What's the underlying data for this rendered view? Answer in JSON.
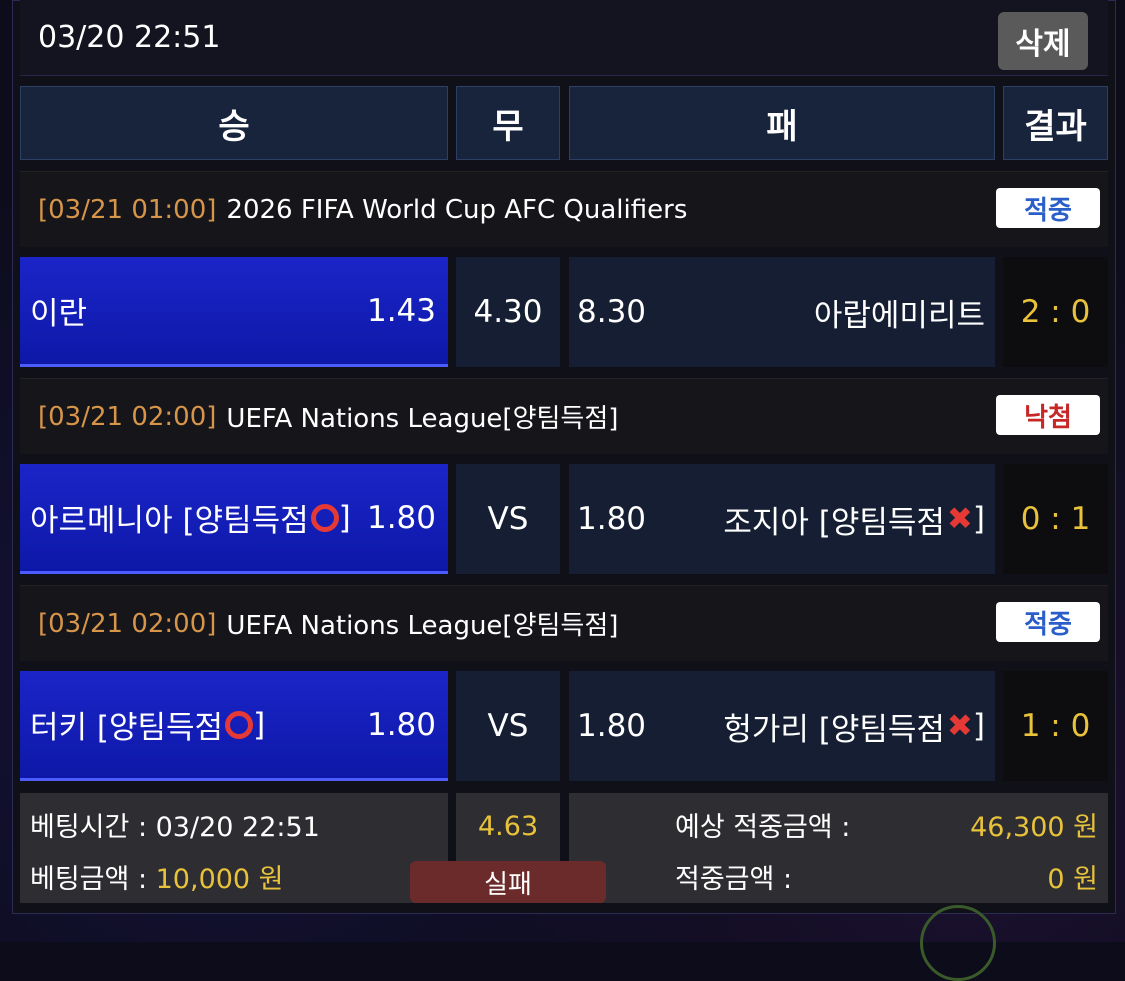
{
  "header": {
    "time": "03/20 22:51",
    "delete_label": "삭제"
  },
  "columns": {
    "win": "승",
    "draw": "무",
    "lose": "패",
    "result": "결과"
  },
  "matches": [
    {
      "date": "[03/21 01:00]",
      "league": "2026 FIFA World Cup AFC Qualifiers",
      "badge": "적중",
      "home": "이란",
      "home_odds": "1.43",
      "draw": "4.30",
      "away_odds": "8.30",
      "away": "아랍에미리트",
      "score": "2 : 0"
    },
    {
      "date": "[03/21 02:00]",
      "league": "UEFA Nations League[양팀득점]",
      "badge": "낙첨",
      "home": "아르메니아 [양팀득점",
      "home_suffix": "]",
      "home_odds": "1.80",
      "draw": "VS",
      "away_odds": "1.80",
      "away": "조지아 [양팀득점",
      "away_suffix": "]",
      "score": "0 : 1"
    },
    {
      "date": "[03/21 02:00]",
      "league": "UEFA Nations League[양팀득점]",
      "badge": "적중",
      "home": "터키 [양팀득점",
      "home_suffix": "]",
      "home_odds": "1.80",
      "draw": "VS",
      "away_odds": "1.80",
      "away": "헝가리 [양팀득점",
      "away_suffix": "]",
      "score": "1 : 0"
    }
  ],
  "summary": {
    "bet_time_label": "베팅시간 : 03/20 22:51",
    "bet_amount_label": "베팅금액 : ",
    "bet_amount_value": "10,000 원",
    "total_odds": "4.63",
    "status": "실패",
    "expected_label": "예상 적중금액 :",
    "expected_value": "46,300 원",
    "win_label": "적중금액 :",
    "win_value": "0 원"
  },
  "colors": {
    "win_bg": "#1b25c8",
    "score": "#e8c23a",
    "date": "#d7954a",
    "hit": "#2a5ec8",
    "miss": "#c62828"
  }
}
